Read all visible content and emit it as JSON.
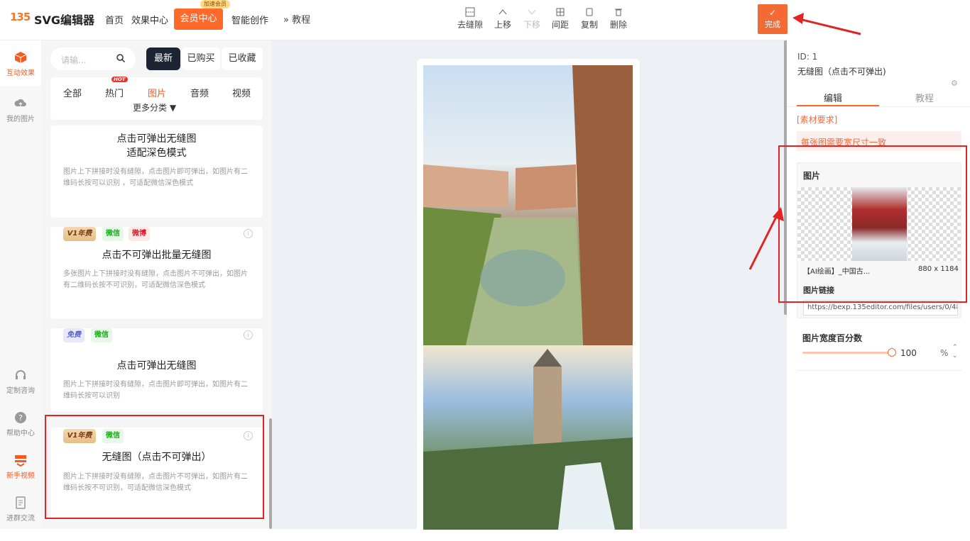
{
  "header": {
    "logo_mark": "135",
    "logo_text": "SVG编辑器",
    "nav": [
      "首页",
      "效果中心"
    ],
    "member_button": "会员中心",
    "member_tag": "加速会员",
    "nav_after": "智能创作"
  },
  "rail": {
    "items": [
      {
        "label": "互动效果",
        "icon": "cube-icon",
        "active": true
      },
      {
        "label": "我的图片",
        "icon": "cloud-upload-icon",
        "active": false
      },
      {
        "label": "定制咨询",
        "icon": "headset-icon",
        "active": false
      },
      {
        "label": "帮助中心",
        "icon": "question-icon",
        "active": false
      },
      {
        "label": "新手视频",
        "icon": "video-icon",
        "active": false
      },
      {
        "label": "进群交流",
        "icon": "document-icon",
        "active": false
      }
    ]
  },
  "panel": {
    "search_placeholder": "请输...",
    "segments": [
      "最新",
      "已购买",
      "已收藏"
    ],
    "categories": [
      "全部",
      "热门",
      "图片",
      "音频",
      "视频"
    ],
    "hot_badge": "HOT",
    "more": "更多分类",
    "cards": [
      {
        "title_line1": "点击可弹出无缝图",
        "title_line2": "适配深色模式",
        "desc": "图片上下拼接时没有缝隙，点击图片即可弹出，如图片有二维码长按可以识别 ，可适配微信深色模式",
        "badges": []
      },
      {
        "title": "点击不可弹出批量无缝图",
        "desc": "多张图片上下拼接时没有缝隙，点击图片不可弹出，如图片有二维码长按不可识别，可适配微信深色模式",
        "badges": [
          "V1年费",
          "微信",
          "微博"
        ]
      },
      {
        "title": "点击可弹出无缝图",
        "desc": "图片上下拼接时没有缝隙，点击图片即可弹出，如图片有二维码长按可以识别",
        "badges": [
          "免费",
          "微信"
        ]
      },
      {
        "title": "无缝图（点击不可弹出）",
        "desc": "图片上下拼接时没有缝隙，点击图片不可弹出，如图片有二维码长按不可识别，可适配微信深色模式",
        "badges": [
          "V1年费",
          "微信"
        ]
      }
    ]
  },
  "toolbar": {
    "expand_label": "教程",
    "actions": [
      {
        "label": "去缝隙",
        "icon": "gap-icon",
        "disabled": false
      },
      {
        "label": "上移",
        "icon": "chevron-up-icon",
        "disabled": false
      },
      {
        "label": "下移",
        "icon": "chevron-down-icon",
        "disabled": true
      },
      {
        "label": "间距",
        "icon": "spacing-icon",
        "disabled": false
      },
      {
        "label": "复制",
        "icon": "copy-icon",
        "disabled": false
      },
      {
        "label": "删除",
        "icon": "trash-icon",
        "disabled": false
      }
    ]
  },
  "right": {
    "done": "完成",
    "id_text": "ID: 1",
    "element_name": "无缝图（点击不可弹出)",
    "tabs": [
      "编辑",
      "教程"
    ],
    "req_label": "[素材要求]",
    "req_note": "每张图需要宽尺寸一致",
    "image_section": "图片",
    "image_name": "【AI绘画】_中国古...",
    "image_size": "880 x 1184",
    "link_label": "图片链接",
    "link_value": "https://bexp.135editor.com/files/users/0/485/2/",
    "width_label": "图片宽度百分数",
    "width_value": "100",
    "width_unit": "%"
  },
  "colors": {
    "accent": "#f36a35",
    "highlight": "#e02424",
    "dark": "#1c2333"
  }
}
